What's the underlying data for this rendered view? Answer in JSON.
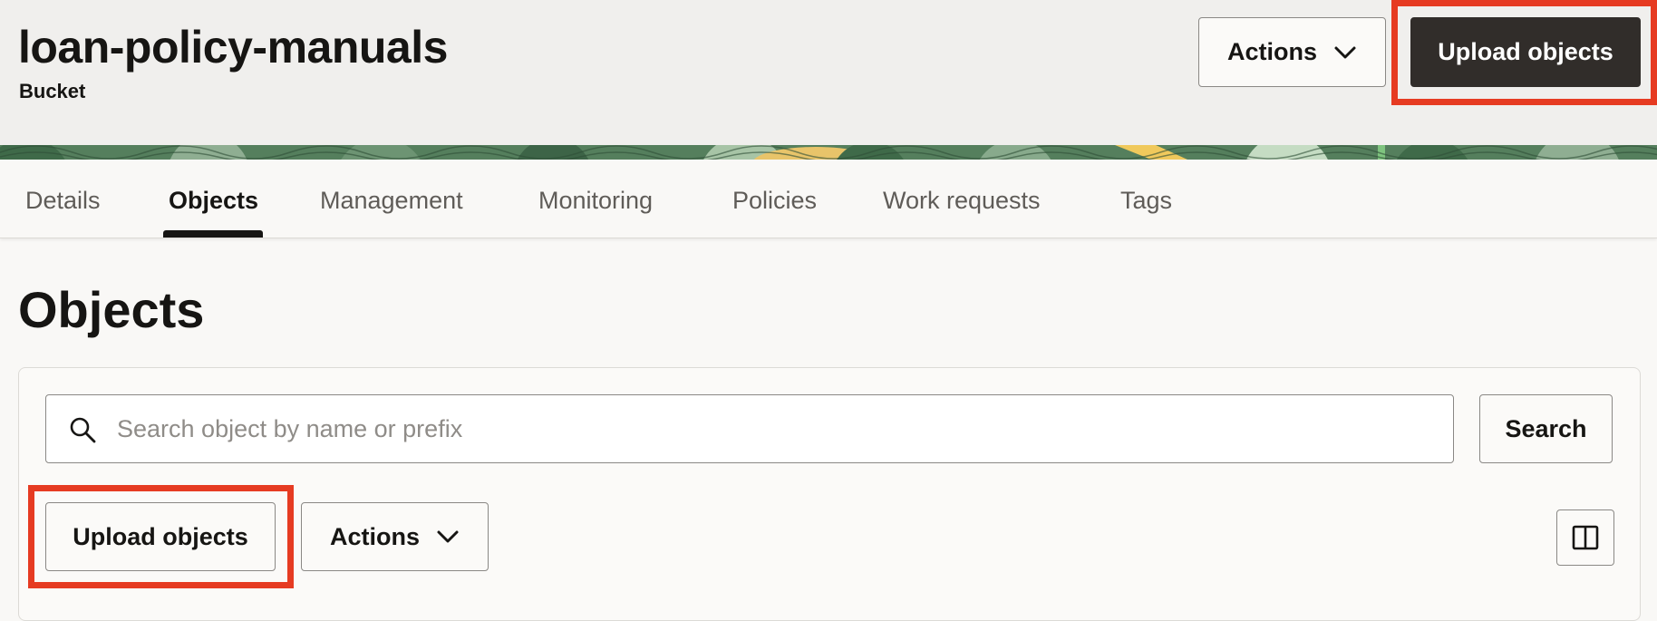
{
  "header": {
    "bucket_name": "loan-policy-manuals",
    "resource_type": "Bucket",
    "actions_label": "Actions",
    "upload_label": "Upload objects"
  },
  "tabs": [
    {
      "label": "Details"
    },
    {
      "label": "Objects",
      "active": true
    },
    {
      "label": "Management"
    },
    {
      "label": "Monitoring"
    },
    {
      "label": "Policies"
    },
    {
      "label": "Work requests"
    },
    {
      "label": "Tags"
    }
  ],
  "objects": {
    "title": "Objects",
    "search_placeholder": "Search object by name or prefix",
    "search_value": "",
    "search_button": "Search",
    "upload_label": "Upload objects",
    "actions_label": "Actions"
  },
  "icons": {
    "search": "search-icon",
    "chevron": "chevron-down-icon",
    "columns": "columns-icon"
  },
  "colors": {
    "primary_button": "#312d2a",
    "highlight": "#e63b22",
    "banner_green": "#4e7a58"
  }
}
